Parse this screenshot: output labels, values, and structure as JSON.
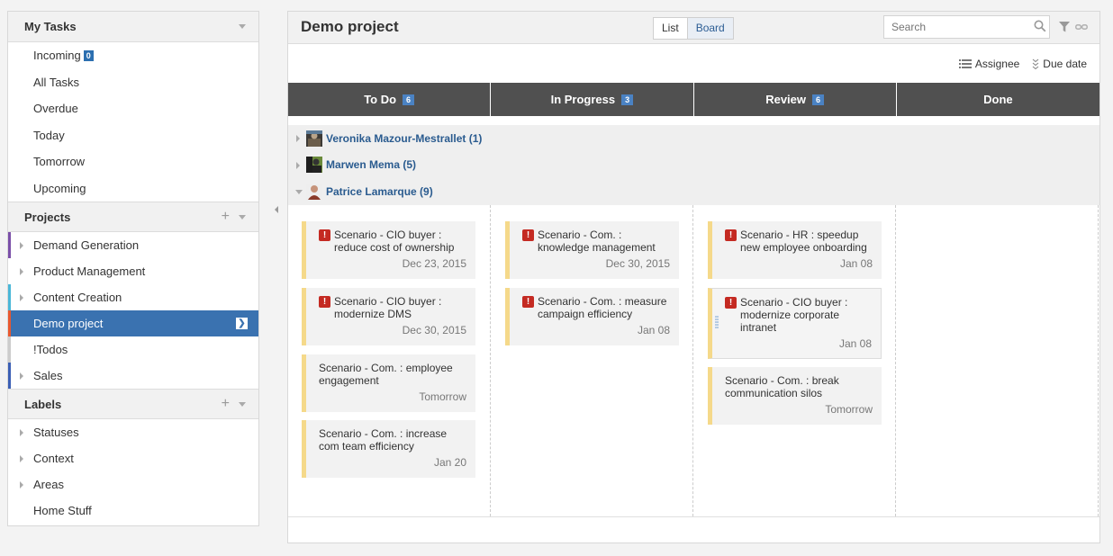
{
  "sidebar": {
    "my_tasks": {
      "title": "My Tasks",
      "items": [
        {
          "label": "Incoming",
          "badge": "0"
        },
        {
          "label": "All Tasks"
        },
        {
          "label": "Overdue"
        },
        {
          "label": "Today"
        },
        {
          "label": "Tomorrow"
        },
        {
          "label": "Upcoming"
        }
      ]
    },
    "projects": {
      "title": "Projects",
      "add": "+",
      "items": [
        {
          "label": "Demand Generation",
          "color": "#7b4fa8"
        },
        {
          "label": "Product Management",
          "color": ""
        },
        {
          "label": "Content Creation",
          "color": "#4ab7d8"
        },
        {
          "label": "Demo project",
          "color": "#e8582f",
          "active": true
        },
        {
          "label": "!Todos",
          "color": "#cccccc"
        },
        {
          "label": "Sales",
          "color": "#3b5fb5"
        }
      ]
    },
    "labels": {
      "title": "Labels",
      "add": "+",
      "items": [
        {
          "label": "Statuses"
        },
        {
          "label": "Context"
        },
        {
          "label": "Areas"
        },
        {
          "label": "Home Stuff"
        }
      ]
    }
  },
  "main": {
    "title": "Demo project",
    "view_toggle": {
      "list": "List",
      "board": "Board",
      "selected": "Board"
    },
    "search": {
      "placeholder": "Search"
    },
    "sort": {
      "assignee": "Assignee",
      "due_date": "Due date"
    },
    "columns": [
      {
        "label": "To Do",
        "count": "6"
      },
      {
        "label": "In Progress",
        "count": "3"
      },
      {
        "label": "Review",
        "count": "6"
      },
      {
        "label": "Done",
        "count": ""
      }
    ],
    "groups": [
      {
        "name": "Veronika Mazour-Mestrallet (1)",
        "expanded": false
      },
      {
        "name": "Marwen Mema (5)",
        "expanded": false
      },
      {
        "name": "Patrice Lamarque (9)",
        "expanded": true
      }
    ],
    "cards": {
      "todo": [
        {
          "title": "Scenario - CIO buyer : reduce cost of ownership",
          "due": "Dec 23, 2015",
          "priority": true
        },
        {
          "title": "Scenario - CIO buyer : modernize DMS",
          "due": "Dec 30, 2015",
          "priority": true
        },
        {
          "title": "Scenario - Com. : employee engagement",
          "due": "Tomorrow",
          "priority": false
        },
        {
          "title": "Scenario - Com. : increase com team efficiency",
          "due": "Jan 20",
          "priority": false
        }
      ],
      "in_progress": [
        {
          "title": "Scenario - Com. : knowledge management",
          "due": "Dec 30, 2015",
          "priority": true
        },
        {
          "title": "Scenario - Com. : measure campaign efficiency",
          "due": "Jan 08",
          "priority": true
        }
      ],
      "review": [
        {
          "title": "Scenario - HR : speedup new employee onboarding",
          "due": "Jan 08",
          "priority": true
        },
        {
          "title": "Scenario - CIO buyer : modernize corporate intranet",
          "due": "Jan 08",
          "priority": true
        },
        {
          "title": "Scenario - Com. : break communication silos",
          "due": "Tomorrow",
          "priority": false
        }
      ]
    },
    "priority_mark": "!",
    "accent_color": "#3a72b0",
    "card_stripe_color": "#f5d98a"
  }
}
